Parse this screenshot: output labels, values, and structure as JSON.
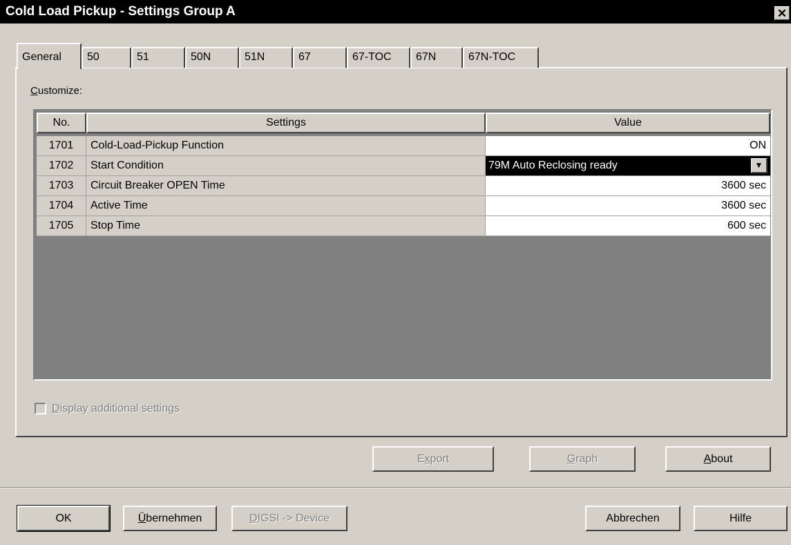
{
  "window": {
    "title": "Cold Load Pickup - Settings Group A",
    "close_glyph": "✕"
  },
  "tabs": [
    "General",
    "50",
    "51",
    "50N",
    "51N",
    "67",
    "67-TOC",
    "67N",
    "67N-TOC"
  ],
  "customize": {
    "label_first": "C",
    "label_rest": "ustomize:"
  },
  "table": {
    "headers": {
      "no": "No.",
      "settings": "Settings",
      "value": "Value"
    },
    "rows": [
      {
        "no": "1701",
        "setting": "Cold-Load-Pickup Function",
        "value": "ON"
      },
      {
        "no": "1702",
        "setting": "Start Condition",
        "value": "79M Auto Reclosing ready"
      },
      {
        "no": "1703",
        "setting": "Circuit Breaker OPEN Time",
        "value": "3600 sec"
      },
      {
        "no": "1704",
        "setting": "Active Time",
        "value": "3600 sec"
      },
      {
        "no": "1705",
        "setting": "Stop Time",
        "value": "600 sec"
      }
    ]
  },
  "additional": {
    "first": "D",
    "rest": "isplay additional settings",
    "checked": false
  },
  "panel_buttons": {
    "export": {
      "pre": "E",
      "u": "x",
      "post": "port"
    },
    "graph": {
      "pre": "",
      "u": "G",
      "post": "raph"
    },
    "about": {
      "pre": "",
      "u": "A",
      "post": "bout"
    }
  },
  "footer_buttons": {
    "ok": "OK",
    "apply": {
      "pre": "",
      "u": "Ü",
      "post": "bernehmen"
    },
    "digsi": {
      "pre": "",
      "u": "D",
      "post": "IGSI -> Device"
    },
    "cancel": "Abbrechen",
    "help": "Hilfe"
  },
  "icons": {
    "dropdown": "chevron-down-icon"
  }
}
